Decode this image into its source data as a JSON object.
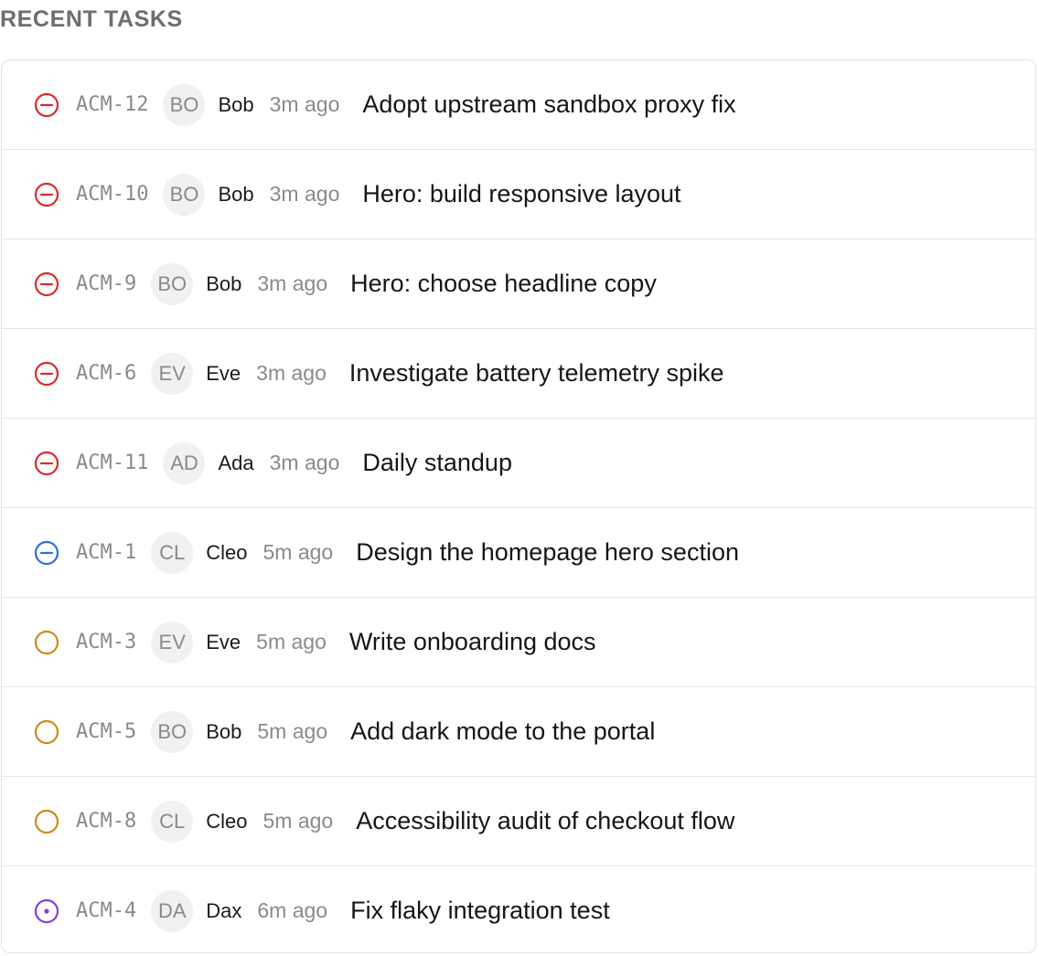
{
  "section": {
    "title": "RECENT TASKS"
  },
  "colors": {
    "status_canceled": "#d92b2b",
    "status_blue": "#2f6fde",
    "status_todo": "#cf8a1a",
    "status_in_progress": "#8a3bd6"
  },
  "tasks": [
    {
      "status": "canceled",
      "status_icon": "minus-circle-icon",
      "id": "ACM-12",
      "avatar": "BO",
      "assignee": "Bob",
      "time": "3m ago",
      "title": "Adopt upstream sandbox proxy fix"
    },
    {
      "status": "canceled",
      "status_icon": "minus-circle-icon",
      "id": "ACM-10",
      "avatar": "BO",
      "assignee": "Bob",
      "time": "3m ago",
      "title": "Hero: build responsive layout"
    },
    {
      "status": "canceled",
      "status_icon": "minus-circle-icon",
      "id": "ACM-9",
      "avatar": "BO",
      "assignee": "Bob",
      "time": "3m ago",
      "title": "Hero: choose headline copy"
    },
    {
      "status": "canceled",
      "status_icon": "minus-circle-icon",
      "id": "ACM-6",
      "avatar": "EV",
      "assignee": "Eve",
      "time": "3m ago",
      "title": "Investigate battery telemetry spike"
    },
    {
      "status": "canceled",
      "status_icon": "minus-circle-icon",
      "id": "ACM-11",
      "avatar": "AD",
      "assignee": "Ada",
      "time": "3m ago",
      "title": "Daily standup"
    },
    {
      "status": "blue",
      "status_icon": "minus-circle-icon",
      "id": "ACM-1",
      "avatar": "CL",
      "assignee": "Cleo",
      "time": "5m ago",
      "title": "Design the homepage hero section"
    },
    {
      "status": "todo",
      "status_icon": "empty-circle-icon",
      "id": "ACM-3",
      "avatar": "EV",
      "assignee": "Eve",
      "time": "5m ago",
      "title": "Write onboarding docs"
    },
    {
      "status": "todo",
      "status_icon": "empty-circle-icon",
      "id": "ACM-5",
      "avatar": "BO",
      "assignee": "Bob",
      "time": "5m ago",
      "title": "Add dark mode to the portal"
    },
    {
      "status": "todo",
      "status_icon": "empty-circle-icon",
      "id": "ACM-8",
      "avatar": "CL",
      "assignee": "Cleo",
      "time": "5m ago",
      "title": "Accessibility audit of checkout flow"
    },
    {
      "status": "in_progress",
      "status_icon": "dot-circle-icon",
      "id": "ACM-4",
      "avatar": "DA",
      "assignee": "Dax",
      "time": "6m ago",
      "title": "Fix flaky integration test"
    }
  ]
}
